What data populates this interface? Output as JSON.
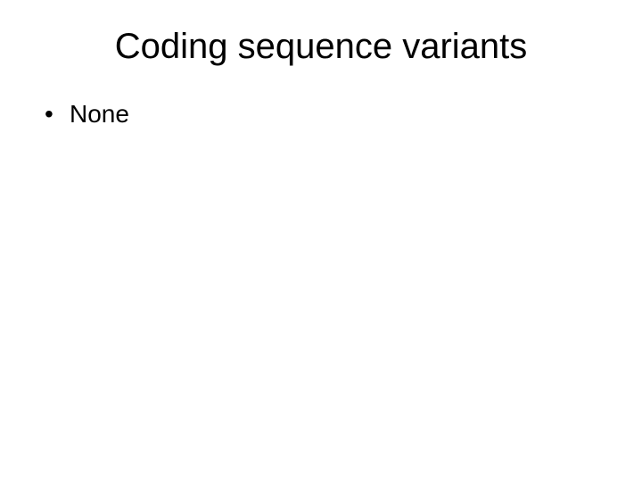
{
  "slide": {
    "title": "Coding sequence variants",
    "bullets": [
      {
        "text": "None"
      }
    ]
  }
}
